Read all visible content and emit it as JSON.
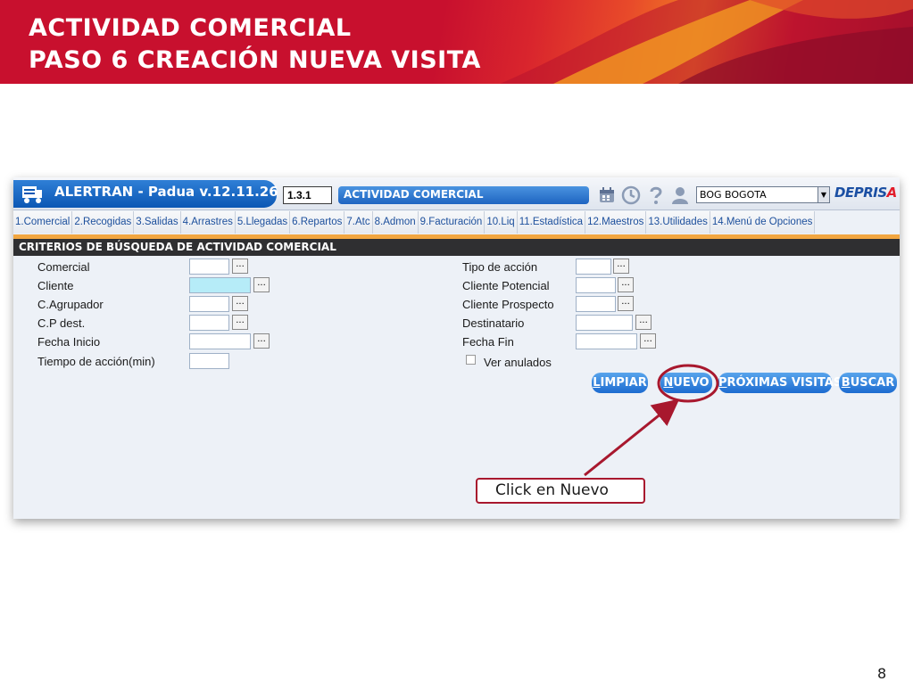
{
  "slide": {
    "title_line1": "ACTIVIDAD COMERCIAL",
    "title_line2": "PASO 6 CREACIÓN NUEVA VISITA",
    "page_number": "8",
    "callout_text": "Click en Nuevo",
    "accent_color": "#c8102e",
    "callout_color": "#a8182e"
  },
  "app": {
    "name": "ALERTRAN - Padua  v.12.11.26",
    "code": "1.3.1",
    "module_title": "ACTIVIDAD COMERCIAL",
    "city_selected": "BOG BOGOTA",
    "brand_main": "DEPRIS",
    "brand_accent": "A",
    "icons": [
      "calendar-icon",
      "clock-icon",
      "help-icon",
      "user-icon"
    ]
  },
  "tabs": [
    "1.Comercial",
    "2.Recogidas",
    "3.Salidas",
    "4.Arrastres",
    "5.Llegadas",
    "6.Repartos",
    "7.Atc",
    "8.Admon",
    "9.Facturación",
    "10.Liq",
    "11.Estadística",
    "12.Maestros",
    "13.Utilidades",
    "14.Menú de Opciones"
  ],
  "section_title": "CRITERIOS DE BÚSQUEDA DE ACTIVIDAD COMERCIAL",
  "form_left": {
    "comercial": "Comercial",
    "cliente": "Cliente",
    "agrupador": "C.Agrupador",
    "cp_dest": "C.P dest.",
    "fecha_inicio": "Fecha Inicio",
    "tiempo_accion": "Tiempo de acción(min)"
  },
  "form_right": {
    "tipo_accion": "Tipo de acción",
    "cliente_potencial": "Cliente Potencial",
    "cliente_prospecto": "Cliente Prospecto",
    "destinatario": "Destinatario",
    "fecha_fin": "Fecha Fin",
    "ver_anulados": "Ver anulados"
  },
  "ellipsis": "...",
  "buttons": {
    "limpiar_key": "L",
    "limpiar_rest": "IMPIAR",
    "nuevo_key": "N",
    "nuevo_rest": "UEVO",
    "proximas_key": "P",
    "proximas_rest": "RÓXIMAS VISITAS",
    "buscar_key": "B",
    "buscar_rest": "USCAR",
    "button_color": "#1c6bd0"
  }
}
